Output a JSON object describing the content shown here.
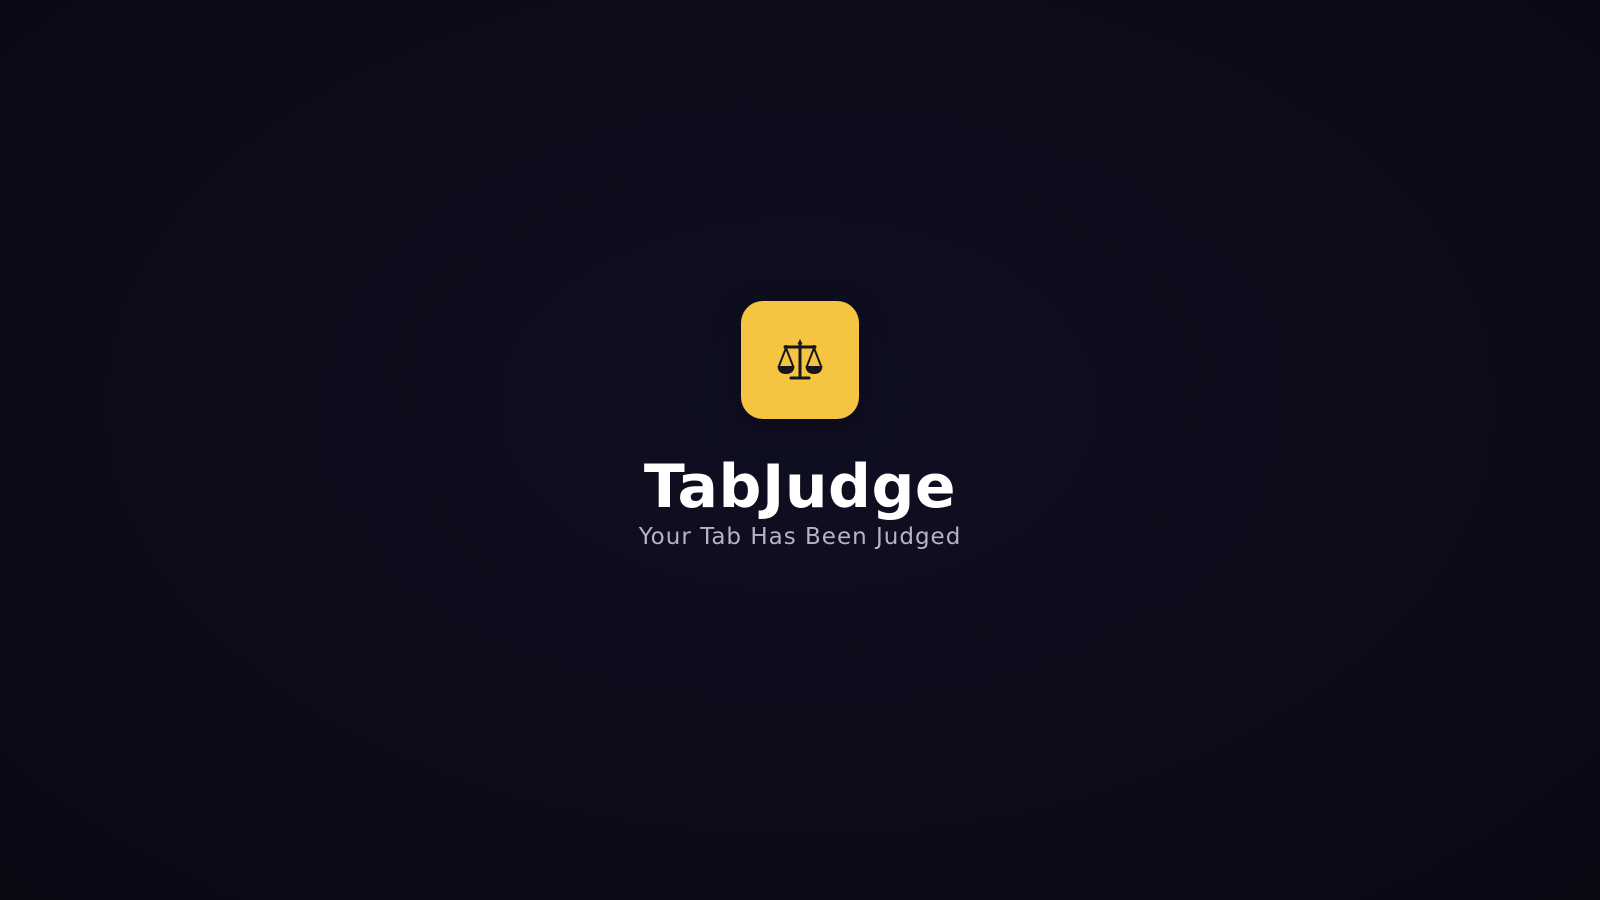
{
  "splash": {
    "app_name": "TabJudge",
    "tagline": "Your Tab Has Been Judged",
    "logo_icon": "scales-of-justice-icon"
  },
  "colors": {
    "background": "#0c0c1b",
    "accent": "#f5c542",
    "title_text": "#ffffff",
    "tagline_text": "#b4b4c3"
  }
}
